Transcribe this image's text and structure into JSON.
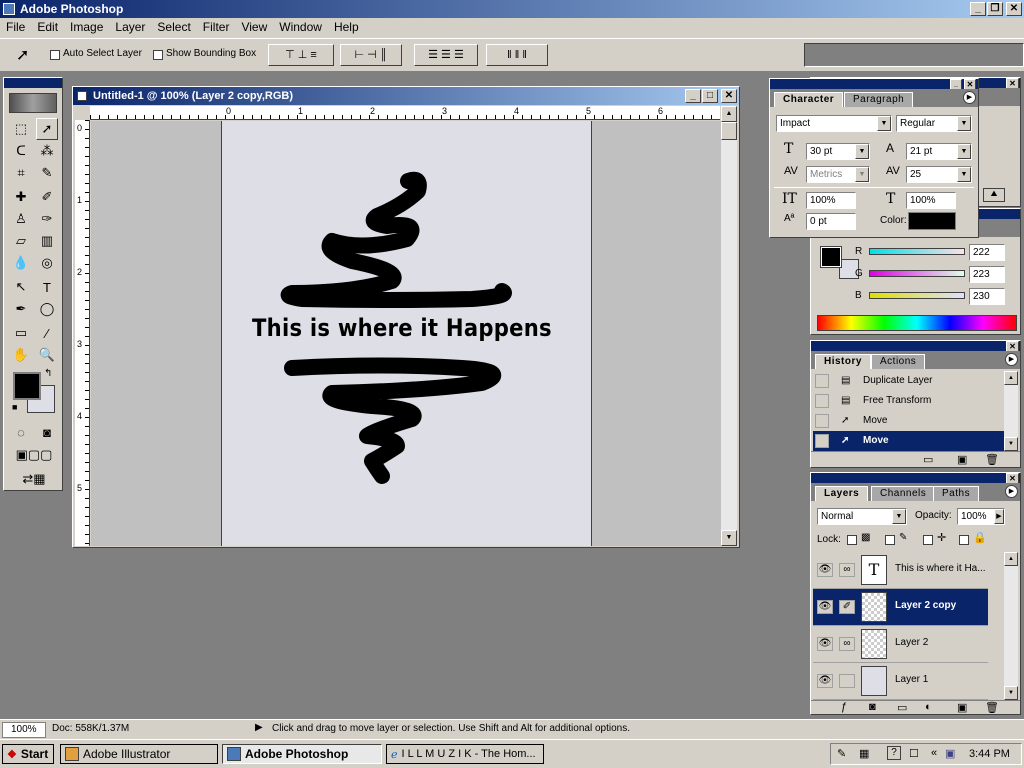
{
  "app": {
    "title": "Adobe Photoshop"
  },
  "menu": [
    "File",
    "Edit",
    "Image",
    "Layer",
    "Select",
    "Filter",
    "View",
    "Window",
    "Help"
  ],
  "options": {
    "auto_select": "Auto Select Layer",
    "show_bounding": "Show Bounding Box"
  },
  "document": {
    "title": "Untitled-1 @ 100% (Layer 2 copy,RGB)",
    "text": "This is where it Happens",
    "ruler_h": [
      "0",
      "1",
      "2",
      "3",
      "4",
      "5",
      "6"
    ],
    "ruler_v": [
      "0",
      "1",
      "2",
      "3",
      "4",
      "5"
    ]
  },
  "character": {
    "tabs": [
      "Character",
      "Paragraph"
    ],
    "font": "Impact",
    "style": "Regular",
    "size": "30 pt",
    "leading": "21 pt",
    "kerning": "Metrics",
    "tracking": "25",
    "vscale": "100%",
    "hscale": "100%",
    "baseline": "0 pt",
    "color_label": "Color:"
  },
  "color": {
    "r_label": "R",
    "g_label": "G",
    "b_label": "B",
    "r": "222",
    "g": "223",
    "b": "230",
    "fg": "#000000",
    "bg": "#dedfe6"
  },
  "history": {
    "tabs": [
      "History",
      "Actions"
    ],
    "items": [
      "Duplicate Layer",
      "Free Transform",
      "Move",
      "Move"
    ]
  },
  "layers": {
    "tabs": [
      "Layers",
      "Channels",
      "Paths"
    ],
    "mode": "Normal",
    "opacity_label": "Opacity:",
    "opacity": "100%",
    "lock_label": "Lock:",
    "items": [
      "This is where it Ha...",
      "Layer 2 copy",
      "Layer 2",
      "Layer 1"
    ]
  },
  "status": {
    "zoom": "100%",
    "doc": "Doc: 558K/1.37M",
    "hint": "Click and drag to move layer or selection.  Use Shift and Alt for additional options."
  },
  "taskbar": {
    "start": "Start",
    "tasks": [
      "Adobe Illustrator",
      "Adobe Photoshop",
      "I L L M U Z I K - The Hom..."
    ],
    "clock": "3:44 PM"
  }
}
